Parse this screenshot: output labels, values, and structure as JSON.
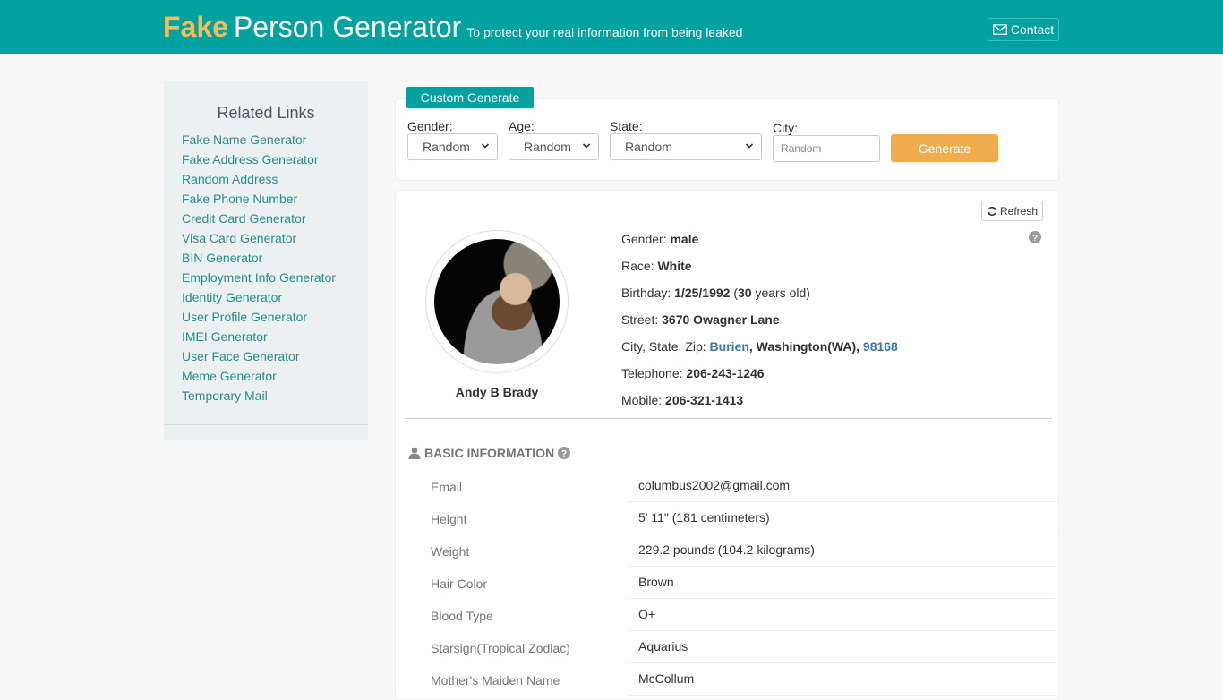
{
  "header": {
    "brand_fake": "Fake",
    "brand_rest": "Person Generator",
    "tagline": "To protect your real information from being leaked",
    "contact_label": "Contact",
    "colors": {
      "bar": "#03a19f",
      "brand_accent": "#f0bd5a"
    }
  },
  "sidebar": {
    "title": "Related Links",
    "links": [
      "Fake Name Generator",
      "Fake Address Generator",
      "Random Address",
      "Fake Phone Number",
      "Credit Card Generator",
      "Visa Card Generator",
      "BIN Generator",
      "Employment Info Generator",
      "Identity Generator",
      "User Profile Generator",
      "IMEI Generator",
      "User Face Generator",
      "Meme Generator",
      "Temporary Mail"
    ]
  },
  "custom_generate": {
    "tab_label": "Custom Generate",
    "gender": {
      "label": "Gender:",
      "value": "Random"
    },
    "age": {
      "label": "Age:",
      "value": "Random"
    },
    "state": {
      "label": "State:",
      "value": "Random"
    },
    "city": {
      "label": "City:",
      "placeholder": "Random",
      "value": ""
    },
    "generate_label": "Generate"
  },
  "profile": {
    "refresh_label": "Refresh",
    "name": "Andy B Brady",
    "gender_label": "Gender: ",
    "gender": "male",
    "race_label": "Race: ",
    "race": "White",
    "birthday_label": "Birthday: ",
    "birthday": "1/25/1992",
    "age_open": " (",
    "age": "30",
    "age_suffix": " years old)",
    "street_label": "Street: ",
    "street": "3670 Owagner Lane",
    "csz_label": "City, State, Zip: ",
    "city": "Burien",
    "state_sep": ", ",
    "state": "Washington(WA)",
    "zip_sep": ", ",
    "zip": "98168",
    "telephone_label": "Telephone: ",
    "telephone": "206-243-1246",
    "mobile_label": "Mobile: ",
    "mobile": "206-321-1413"
  },
  "basic_info": {
    "title": "BASIC INFORMATION",
    "rows": [
      {
        "key": "Email",
        "value": "columbus2002@gmail.com"
      },
      {
        "key": "Height",
        "value": "5' 11\" (181 centimeters)"
      },
      {
        "key": "Weight",
        "value": "229.2 pounds (104.2 kilograms)"
      },
      {
        "key": "Hair Color",
        "value": "Brown"
      },
      {
        "key": "Blood Type",
        "value": "O+"
      },
      {
        "key": "Starsign(Tropical Zodiac)",
        "value": "Aquarius"
      },
      {
        "key": "Mother's Maiden Name",
        "value": "McCollum"
      }
    ]
  }
}
